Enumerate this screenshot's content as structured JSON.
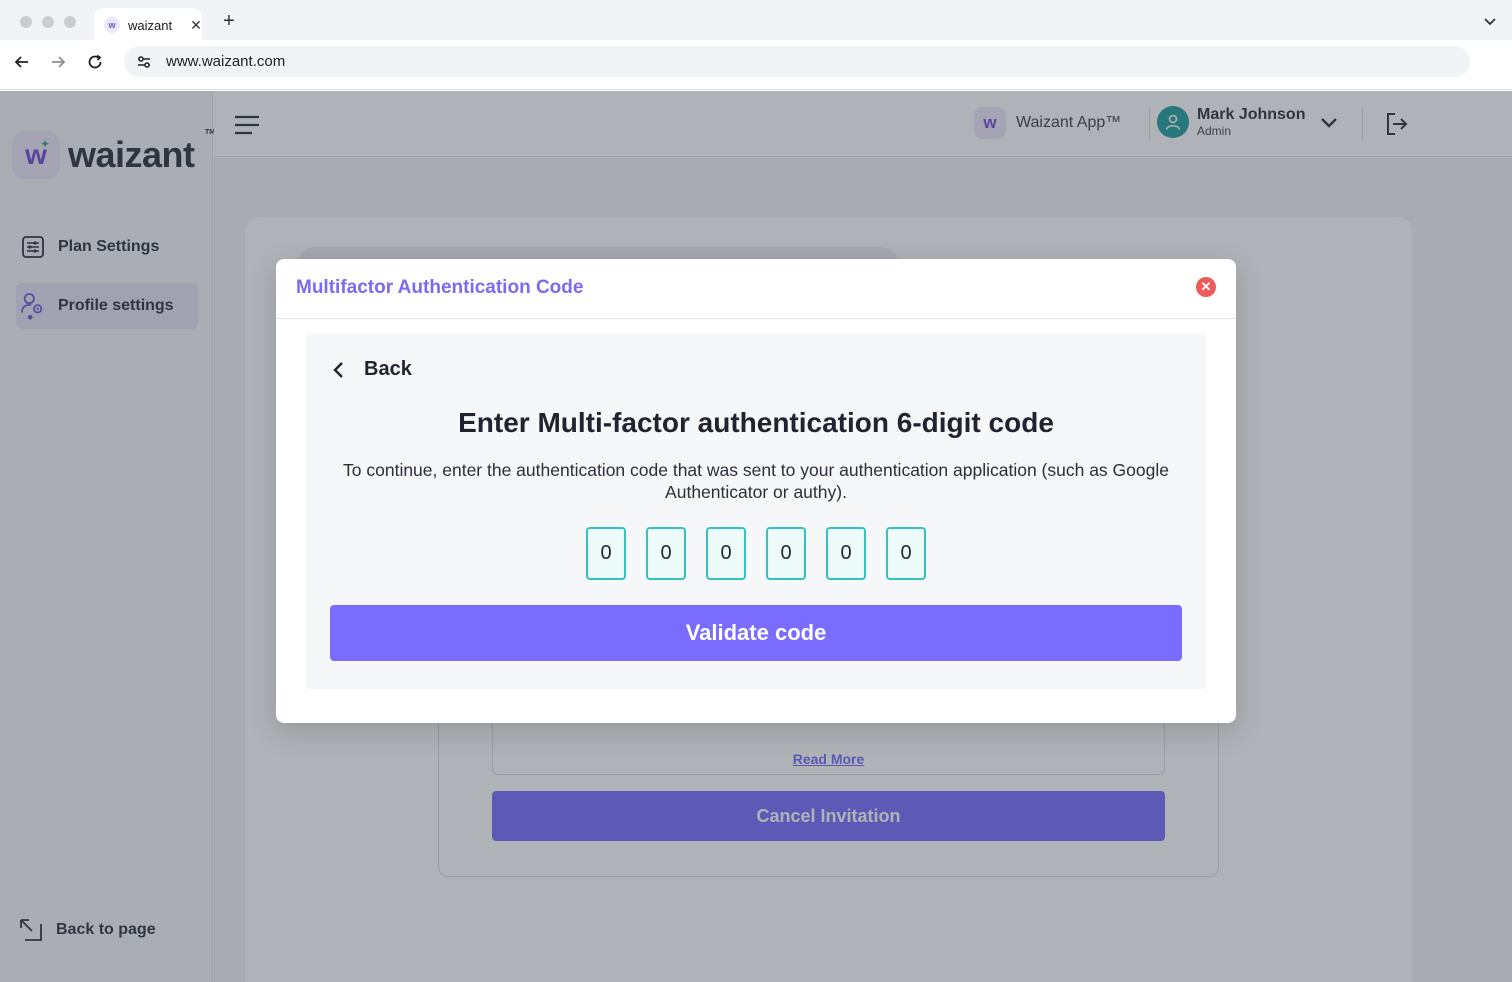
{
  "browser": {
    "tab_title": "waizant",
    "tab_favicon": "w",
    "url": "www.waizant.com",
    "close_tab_glyph": "✕",
    "new_tab_glyph": "+"
  },
  "sidebar": {
    "logo_mark": "w",
    "logo_text": "waizant",
    "logo_tm": "TM",
    "items": [
      {
        "label": "Plan Settings",
        "icon": "plan-settings-icon"
      },
      {
        "label": "Profile settings",
        "icon": "profile-settings-icon"
      }
    ],
    "back_label": "Back to page"
  },
  "header": {
    "app_name": "Waizant App™",
    "app_icon": "w",
    "user_name": "Mark Johnson",
    "user_role": "Admin"
  },
  "background": {
    "read_more": "Read More",
    "cancel_invitation": "Cancel Invitation"
  },
  "modal": {
    "title": "Multifactor Authentication Code",
    "close_glyph": "✕",
    "back_label": "Back",
    "heading": "Enter Multi-factor authentication 6-digit code",
    "description": "To continue, enter the authentication code that was sent to your authentication application (such as Google Authenticator or authy).",
    "code": [
      "0",
      "0",
      "0",
      "0",
      "0",
      "0"
    ],
    "validate_label": "Validate code"
  },
  "colors": {
    "accent": "#7a6cff",
    "modal_title": "#7a6bf0",
    "code_border": "#35c3c0",
    "close_button": "#ef5a5a",
    "avatar": "#119a9a"
  }
}
